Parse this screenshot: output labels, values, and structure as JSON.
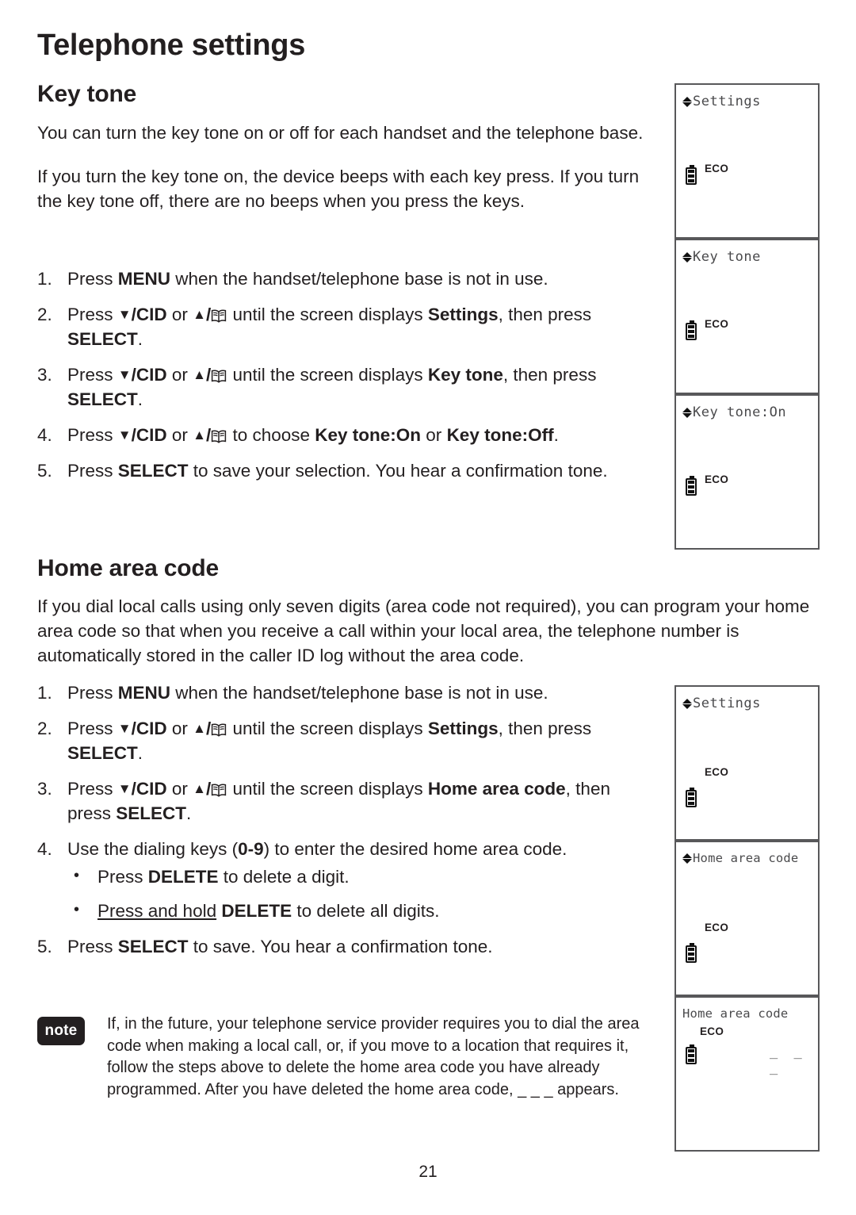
{
  "document": {
    "chapter_title": "Telephone settings",
    "page_number": "21"
  },
  "sections": [
    {
      "id": "key-tone",
      "heading": "Key tone",
      "paragraphs": [
        "You can turn the key tone on or off for each handset and the telephone base.",
        "If you turn the key tone on, the device beeps with each key press. If you turn the key tone off, there are no beeps when you press the keys."
      ],
      "steps": [
        {
          "num": "1.",
          "text_parts": [
            {
              "t": "Press ",
              "s": "n"
            },
            {
              "t": "MENU",
              "s": "b"
            },
            {
              "t": " when the handset/telephone base is not in use.",
              "s": "n"
            }
          ]
        },
        {
          "num": "2.",
          "text_parts": [
            {
              "t": "Press ",
              "s": "n"
            },
            {
              "t": "▼",
              "s": "k"
            },
            {
              "t": "/CID",
              "s": "b"
            },
            {
              "t": " or ",
              "s": "n"
            },
            {
              "t": "▲",
              "s": "k"
            },
            {
              "t": "/",
              "s": "b"
            },
            {
              "t": "",
              "s": "book"
            },
            {
              "t": " until the screen displays ",
              "s": "n"
            },
            {
              "t": "Settings",
              "s": "b"
            },
            {
              "t": ", then press ",
              "s": "n"
            },
            {
              "t": "SELECT",
              "s": "b"
            },
            {
              "t": ".",
              "s": "n"
            }
          ]
        },
        {
          "num": "3.",
          "text_parts": [
            {
              "t": "Press ",
              "s": "n"
            },
            {
              "t": "▼",
              "s": "k"
            },
            {
              "t": "/CID",
              "s": "b"
            },
            {
              "t": " or ",
              "s": "n"
            },
            {
              "t": "▲",
              "s": "k"
            },
            {
              "t": "/",
              "s": "b"
            },
            {
              "t": "",
              "s": "book"
            },
            {
              "t": " until the screen displays ",
              "s": "n"
            },
            {
              "t": "Key tone",
              "s": "b"
            },
            {
              "t": ", then press ",
              "s": "n"
            },
            {
              "t": "SELECT",
              "s": "b"
            },
            {
              "t": ".",
              "s": "n"
            }
          ]
        },
        {
          "num": "4.",
          "text_parts": [
            {
              "t": "Press ",
              "s": "n"
            },
            {
              "t": "▼",
              "s": "k"
            },
            {
              "t": "/CID",
              "s": "b"
            },
            {
              "t": " or ",
              "s": "n"
            },
            {
              "t": "▲",
              "s": "k"
            },
            {
              "t": "/",
              "s": "b"
            },
            {
              "t": "",
              "s": "book"
            },
            {
              "t": " to choose ",
              "s": "n"
            },
            {
              "t": "Key tone:On",
              "s": "b"
            },
            {
              "t": " or ",
              "s": "n"
            },
            {
              "t": "Key tone:Off",
              "s": "b"
            },
            {
              "t": ".",
              "s": "n"
            }
          ]
        },
        {
          "num": "5.",
          "text_parts": [
            {
              "t": "Press ",
              "s": "n"
            },
            {
              "t": "SELECT",
              "s": "b"
            },
            {
              "t": " to save your selection. You hear a confirmation tone.",
              "s": "n"
            }
          ]
        }
      ]
    },
    {
      "id": "home-area-code",
      "heading": "Home area code",
      "paragraphs": [
        "If you dial local calls using only seven digits (area code not required), you can program your home area code so that when you receive a call within your local area, the telephone number is automatically stored in the caller ID log without the area code."
      ],
      "steps": [
        {
          "num": "1.",
          "text_parts": [
            {
              "t": "Press ",
              "s": "n"
            },
            {
              "t": "MENU",
              "s": "b"
            },
            {
              "t": " when the handset/telephone base is not in use.",
              "s": "n"
            }
          ]
        },
        {
          "num": "2.",
          "text_parts": [
            {
              "t": "Press ",
              "s": "n"
            },
            {
              "t": "▼",
              "s": "k"
            },
            {
              "t": "/CID",
              "s": "b"
            },
            {
              "t": " or ",
              "s": "n"
            },
            {
              "t": "▲",
              "s": "k"
            },
            {
              "t": "/",
              "s": "b"
            },
            {
              "t": "",
              "s": "book"
            },
            {
              "t": " until the screen displays ",
              "s": "n"
            },
            {
              "t": "Settings",
              "s": "b"
            },
            {
              "t": ", then press ",
              "s": "n"
            },
            {
              "t": "SELECT",
              "s": "b"
            },
            {
              "t": ".",
              "s": "n"
            }
          ]
        },
        {
          "num": "3.",
          "text_parts": [
            {
              "t": "Press ",
              "s": "n"
            },
            {
              "t": "▼",
              "s": "k"
            },
            {
              "t": "/CID",
              "s": "b"
            },
            {
              "t": " or ",
              "s": "n"
            },
            {
              "t": "▲",
              "s": "k"
            },
            {
              "t": "/",
              "s": "b"
            },
            {
              "t": "",
              "s": "book"
            },
            {
              "t": " until the screen displays ",
              "s": "n"
            },
            {
              "t": "Home area code",
              "s": "b"
            },
            {
              "t": ", then press ",
              "s": "n"
            },
            {
              "t": "SELECT",
              "s": "b"
            },
            {
              "t": ".",
              "s": "n"
            }
          ]
        },
        {
          "num": "4.",
          "text_parts": [
            {
              "t": "Use the dialing keys (",
              "s": "n"
            },
            {
              "t": "0-9",
              "s": "b"
            },
            {
              "t": ") to enter the desired home area code.",
              "s": "n"
            }
          ],
          "bullets": [
            [
              {
                "t": "Press ",
                "s": "n"
              },
              {
                "t": "DELETE",
                "s": "b"
              },
              {
                "t": " to delete a digit.",
                "s": "n"
              }
            ],
            [
              {
                "t": "Press and hold",
                "s": "u"
              },
              {
                "t": " ",
                "s": "n"
              },
              {
                "t": "DELETE",
                "s": "b"
              },
              {
                "t": " to delete all digits.",
                "s": "n"
              }
            ]
          ]
        },
        {
          "num": "5.",
          "text_parts": [
            {
              "t": "Press ",
              "s": "n"
            },
            {
              "t": "SELECT",
              "s": "b"
            },
            {
              "t": " to save. You hear a confirmation tone.",
              "s": "n"
            }
          ]
        }
      ]
    }
  ],
  "note": {
    "badge_label": "note",
    "text": "If, in the future, your telephone service provider requires you to dial the area code when making a local call, or, if you move to a location that requires it, follow the steps above to delete the home area code you have already programmed. After you have deleted the home area code, _ _ _ appears."
  },
  "lcd_screens": [
    {
      "id": "lcd-settings-1",
      "group": "key-tone",
      "title": "Settings",
      "has_diamond": true,
      "eco_label": "ECO",
      "eco_position": "right-of-battery",
      "dashes": ""
    },
    {
      "id": "lcd-key-tone",
      "group": "key-tone",
      "title": "Key tone",
      "has_diamond": true,
      "eco_label": "ECO",
      "eco_position": "right-of-battery",
      "dashes": ""
    },
    {
      "id": "lcd-key-tone-on",
      "group": "key-tone",
      "title": "Key tone:On",
      "has_diamond": true,
      "eco_label": "ECO",
      "eco_position": "right-of-battery",
      "dashes": ""
    },
    {
      "id": "lcd-settings-2",
      "group": "home-area-code",
      "title": "Settings",
      "has_diamond": true,
      "eco_label": "ECO",
      "eco_position": "above-battery",
      "dashes": ""
    },
    {
      "id": "lcd-home-area-code",
      "group": "home-area-code",
      "title": "Home area code",
      "has_diamond": true,
      "eco_label": "ECO",
      "eco_position": "above-battery",
      "dashes": ""
    },
    {
      "id": "lcd-home-area-blank",
      "group": "home-area-code",
      "title": "Home area code",
      "has_diamond": false,
      "eco_label": "ECO",
      "eco_position": "under-title",
      "dashes": "_ _ _"
    }
  ],
  "colors": {
    "text": "#231f20",
    "lcd_border": "#58585a",
    "lcd_text": "#4a4a4c",
    "note_badge_bg": "#231f20"
  }
}
